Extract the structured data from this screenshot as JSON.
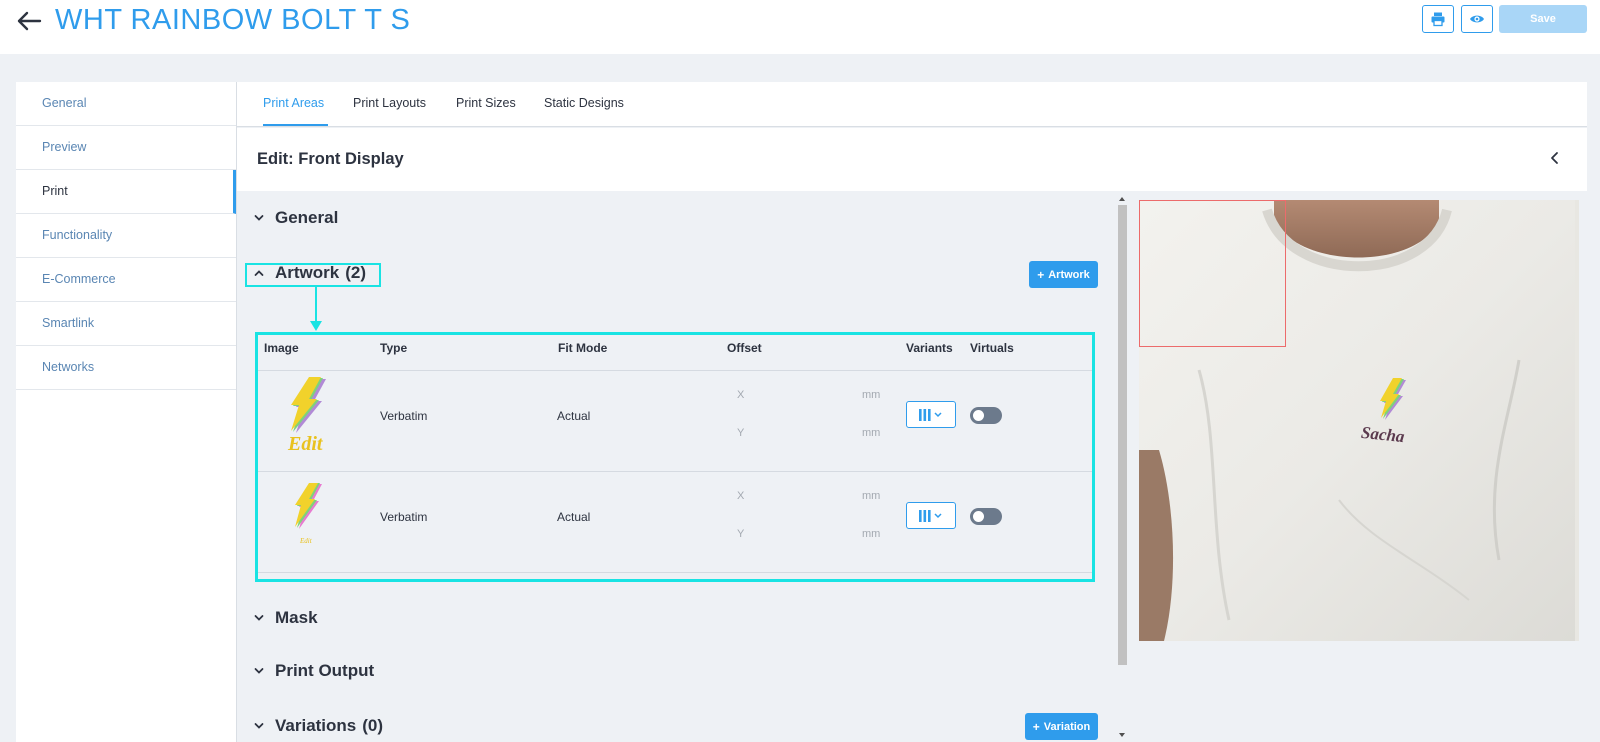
{
  "header": {
    "title": "WHT RAINBOW BOLT T S",
    "save_label": "Save",
    "icons": [
      "back-arrow-icon",
      "print-icon",
      "eye-icon"
    ]
  },
  "sidebar": {
    "items": [
      {
        "label": "General"
      },
      {
        "label": "Preview"
      },
      {
        "label": "Print"
      },
      {
        "label": "Functionality"
      },
      {
        "label": "E-Commerce"
      },
      {
        "label": "Smartlink"
      },
      {
        "label": "Networks"
      }
    ]
  },
  "tabs": [
    {
      "label": "Print Areas"
    },
    {
      "label": "Print Layouts"
    },
    {
      "label": "Print Sizes"
    },
    {
      "label": "Static Designs"
    }
  ],
  "editor": {
    "title": "Edit: Front Display"
  },
  "sections": {
    "general": "General",
    "artwork": "Artwork",
    "artwork_count": "(2)",
    "mask": "Mask",
    "print_output": "Print Output",
    "variations": "Variations",
    "variations_count": "(0)"
  },
  "buttons": {
    "add_artwork": "Artwork",
    "add_variation": "Variation"
  },
  "artwork_table": {
    "columns": [
      "Image",
      "Type",
      "Fit Mode",
      "Offset",
      "Variants",
      "Virtuals"
    ],
    "offset_x_label": "X",
    "offset_y_label": "Y",
    "unit": "mm",
    "rows": [
      {
        "image_text": "Edit",
        "type": "Verbatim",
        "fit_mode": "Actual",
        "virtual_enabled": false
      },
      {
        "image_text": "Edit",
        "type": "Verbatim",
        "fit_mode": "Actual",
        "virtual_enabled": false
      }
    ]
  },
  "preview": {
    "shirt_print_text": "Sacha"
  },
  "colors": {
    "accent": "#2f9cec",
    "highlight": "#19e3e3",
    "print_area_border": "#ec6b6b",
    "save_disabled": "#a9d6f7"
  }
}
